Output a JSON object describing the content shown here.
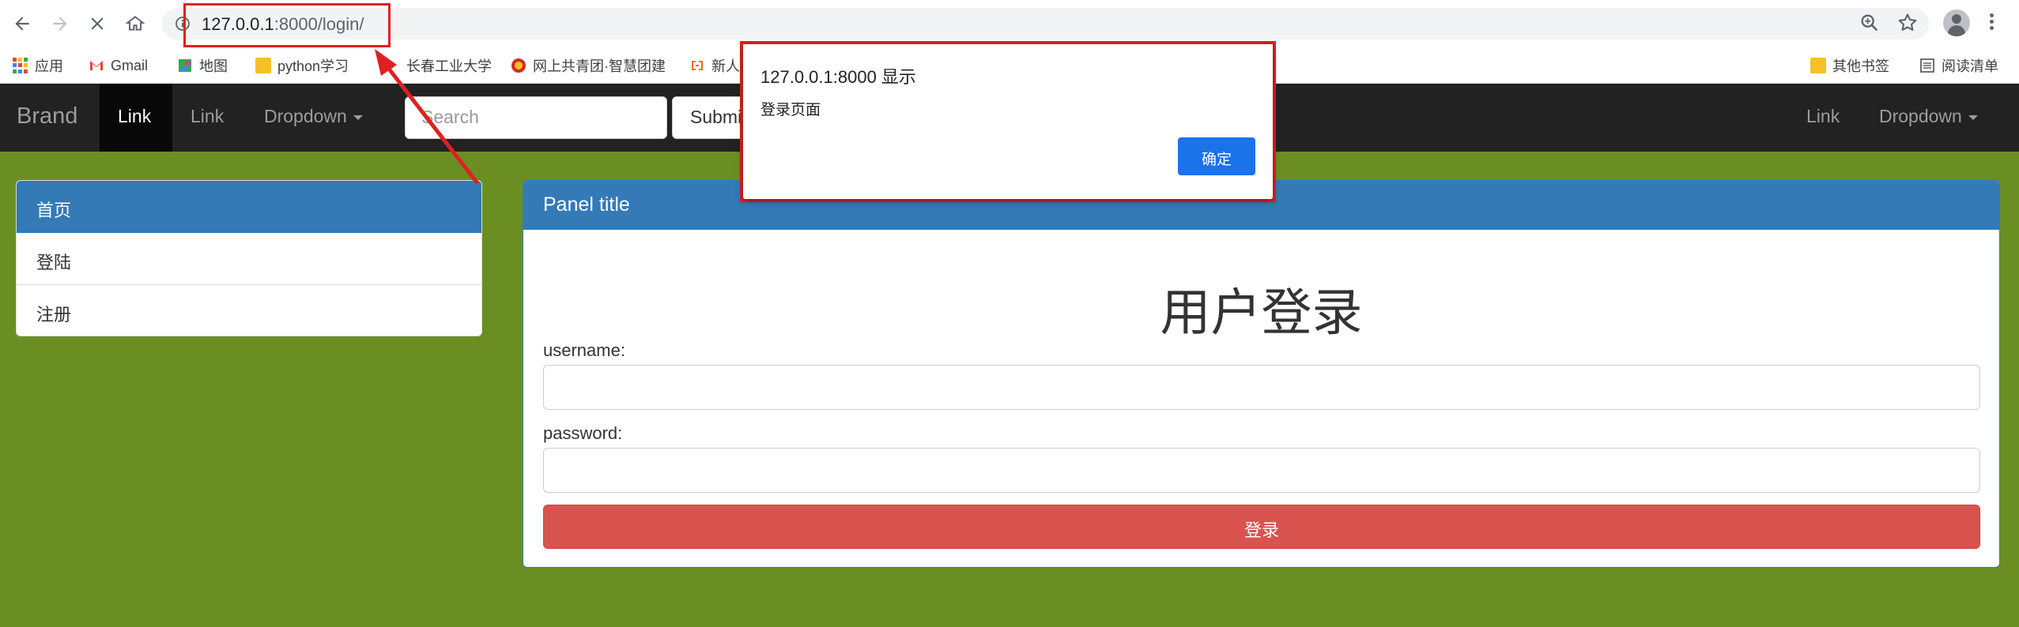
{
  "browser": {
    "url_host": "127.0.0.1",
    "url_rest": ":8000/login/",
    "bookmarks": [
      {
        "label": "应用",
        "icon": "apps-icon"
      },
      {
        "label": "Gmail",
        "icon": "gmail-icon"
      },
      {
        "label": "地图",
        "icon": "maps-icon"
      },
      {
        "label": "python学习",
        "icon": "folder-icon"
      },
      {
        "label": "长春工业大学",
        "icon": "site-icon"
      },
      {
        "label": "网上共青团·智慧团建",
        "icon": "site-icon"
      },
      {
        "label": "新人",
        "icon": "site-icon"
      },
      {
        "label": "其他书签",
        "icon": "folder-icon"
      },
      {
        "label": "阅读清单",
        "icon": "reading-list-icon"
      }
    ]
  },
  "navbar": {
    "brand": "Brand",
    "link_active": "Link",
    "link_2": "Link",
    "dropdown": "Dropdown",
    "search_placeholder": "Search",
    "submit": "Submit",
    "right_link": "Link",
    "right_dropdown": "Dropdown"
  },
  "sidebar": {
    "items": [
      {
        "label": "首页"
      },
      {
        "label": "登陆"
      },
      {
        "label": "注册"
      }
    ]
  },
  "panel": {
    "title": "Panel title",
    "form_title": "用户登录",
    "username_label": "username:",
    "password_label": "password:",
    "login_button": "登录"
  },
  "dialog": {
    "title": "127.0.0.1:8000 显示",
    "message": "登录页面",
    "ok": "确定"
  },
  "colors": {
    "page_bg": "#6b8e23",
    "primary": "#337ab7",
    "danger": "#d9534f",
    "annotation": "#e02020"
  }
}
